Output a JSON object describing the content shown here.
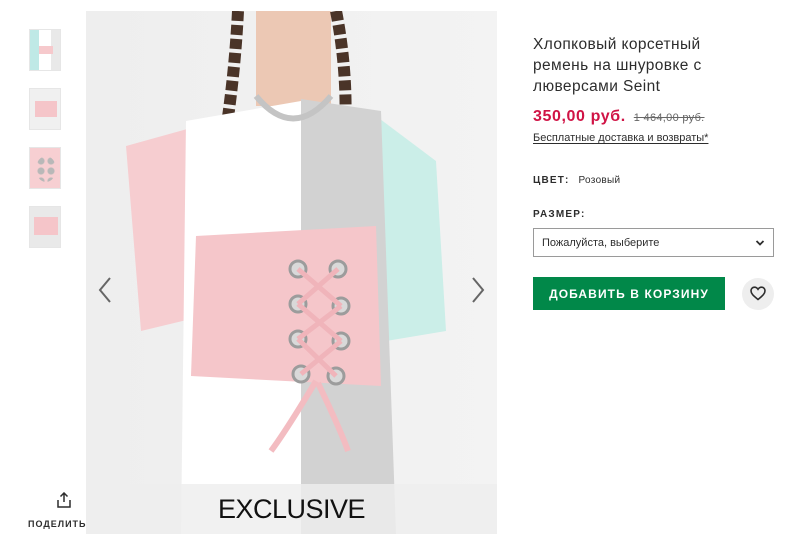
{
  "gallery": {
    "thumbnails": [
      {
        "icon": "product-thumbnail-model"
      },
      {
        "icon": "product-thumbnail-belt-front"
      },
      {
        "icon": "product-thumbnail-eyelets"
      },
      {
        "icon": "product-thumbnail-belt-flat"
      }
    ],
    "badge": "EXCLUSIVE",
    "prev_icon": "chevron-left-icon",
    "next_icon": "chevron-right-icon"
  },
  "share": {
    "label": "ПОДЕЛИТЬ",
    "icon": "share-icon"
  },
  "product": {
    "title": "Хлопковый корсетный ремень на шнуровке с люверсами Seint",
    "price": "350,00 руб.",
    "old_price": "1 464,00 руб.",
    "delivery_link": "Бесплатные доставка и возвраты*",
    "color_label": "ЦВЕТ:",
    "color_value": "Розовый",
    "size_label": "РАЗМЕР:",
    "size_select": {
      "selected": "Пожалуйста, выберите",
      "icon": "chevron-down-icon"
    },
    "add_to_bag": "ДОБАВИТЬ В КОРЗИНУ",
    "wishlist_icon": "heart-icon"
  },
  "colors": {
    "price_red": "#d01345",
    "add_button_green": "#018849",
    "text": "#2d2d2d"
  }
}
